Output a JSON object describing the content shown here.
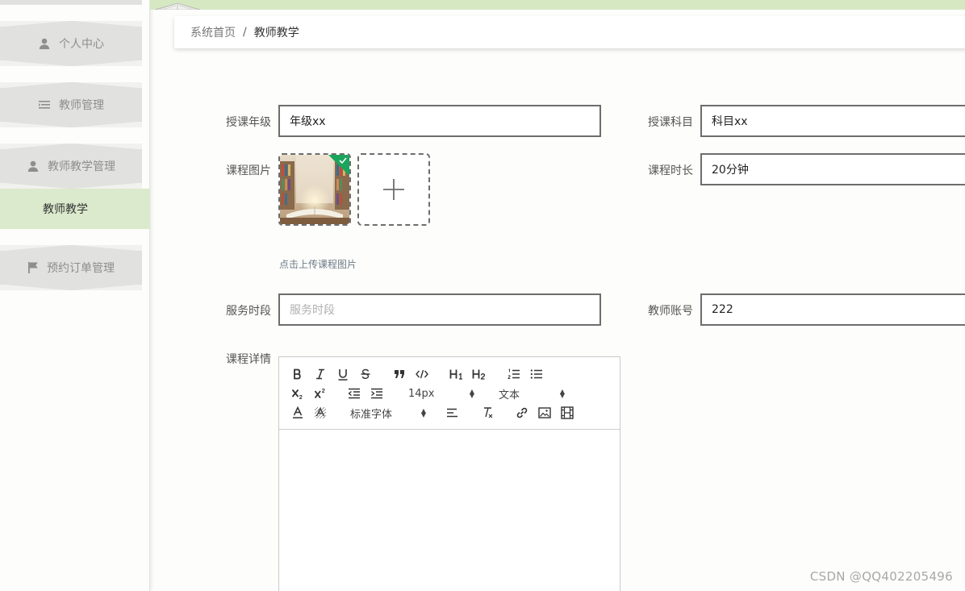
{
  "sidebar": {
    "items": [
      {
        "label": "个人中心",
        "icon": "user-icon"
      },
      {
        "label": "教师管理",
        "icon": "list-icon"
      },
      {
        "label": "教师教学管理",
        "icon": "user-icon"
      },
      {
        "label": "预约订单管理",
        "icon": "flag-icon"
      }
    ],
    "active_sub": "教师教学"
  },
  "breadcrumb": {
    "home": "系统首页",
    "separator": "/",
    "current": "教师教学"
  },
  "form": {
    "grade_label": "授课年级",
    "grade_value": "年级xx",
    "subject_label": "授课科目",
    "subject_value": "科目xx",
    "image_label": "课程图片",
    "upload_tip": "点击上传课程图片",
    "duration_label": "课程时长",
    "duration_value": "20分钟",
    "service_label": "服务时段",
    "service_placeholder": "服务时段",
    "teacher_label": "教师账号",
    "teacher_value": "222",
    "detail_label": "课程详情"
  },
  "editor": {
    "font_size": "14px",
    "header_select": "文本",
    "font_family": "标准字体"
  },
  "watermark": "CSDN @QQ402205496",
  "colors": {
    "accent_green": "#dbe9cc",
    "topbar_green": "#d6e8c2",
    "menu_gray": "#e1e1df",
    "input_border": "#6d6d6d",
    "corner_green": "#19a55c"
  }
}
